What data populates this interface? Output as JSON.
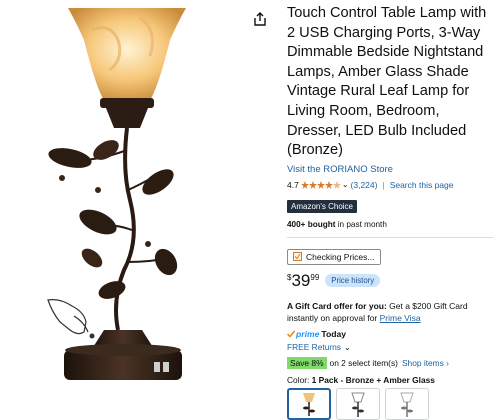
{
  "product": {
    "title": "Touch Control Table Lamp with 2 USB Charging Ports, 3-Way Dimmable Bedside Nightstand Lamps, Amber Glass Shade Vintage Rural Leaf Lamp for Living Room, Bedroom, Dresser, LED Bulb Included (Bronze)",
    "store_link": "Visit the RORIANO Store",
    "rating": "4.7",
    "rating_count": "(3,224)",
    "search_link": "Search this page",
    "choice_badge": "Amazon's Choice",
    "bought_bold": "400+ bought",
    "bought_rest": " in past month",
    "rating_stars": 4.7
  },
  "pricing": {
    "checking_label": "Checking Prices...",
    "currency": "$",
    "whole": "39",
    "fraction": "99",
    "history_label": "Price history"
  },
  "gift": {
    "bold": "A Gift Card offer for you:",
    "text": " Get a $200 Gift Card instantly on approval for ",
    "link": "Prime Visa"
  },
  "delivery": {
    "prime": "prime",
    "today": "Today",
    "returns": "FREE Returns"
  },
  "promo": {
    "save_badge": "Save 8%",
    "save_text": "on 2 select item(s)",
    "shop_link": "Shop items ›"
  },
  "variant": {
    "label": "Color:",
    "value": "1 Pack - Bronze + Amber Glass"
  },
  "colors": {
    "link": "#2162a1",
    "choice_bg": "#232f3e",
    "save_green": "#7fda69",
    "prime_blue": "#1a98ff",
    "star": "#de7921"
  },
  "icons": {
    "share": "share-icon",
    "checkbox": "price-tracker-icon"
  }
}
